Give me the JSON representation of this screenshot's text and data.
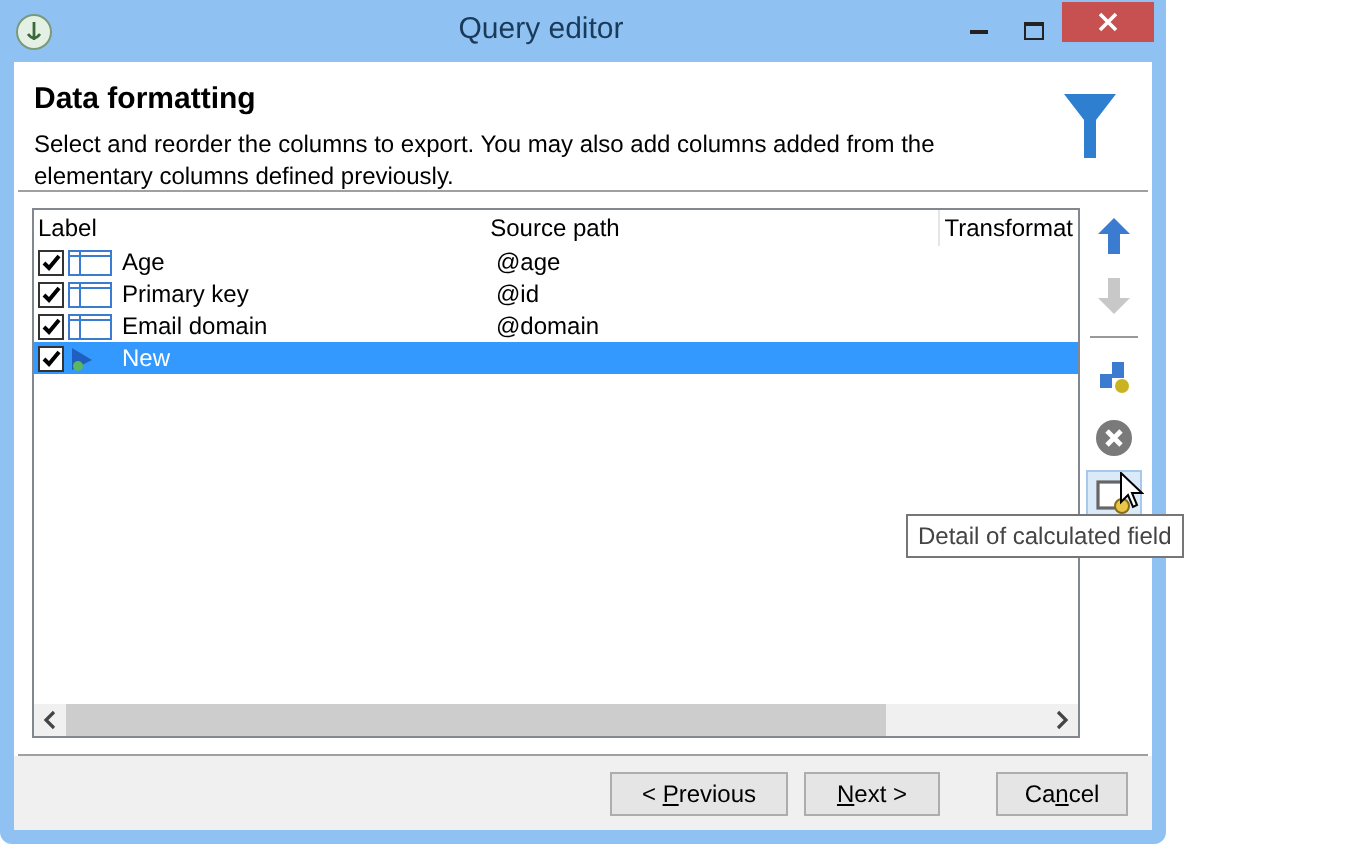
{
  "window": {
    "title": "Query editor"
  },
  "header": {
    "title": "Data formatting",
    "description": "Select and reorder the columns to export. You may also add columns added from the elementary columns defined previously."
  },
  "table": {
    "columns": [
      "Label",
      "Source path",
      "Transformat"
    ],
    "rows": [
      {
        "label": "Age",
        "source": "@age",
        "checked": true,
        "kind": "column",
        "selected": false
      },
      {
        "label": "Primary key",
        "source": "@id",
        "checked": true,
        "kind": "column",
        "selected": false
      },
      {
        "label": "Email domain",
        "source": "@domain",
        "checked": true,
        "kind": "column",
        "selected": false
      },
      {
        "label": "New",
        "checked": true,
        "kind": "calculated",
        "selected": true
      }
    ]
  },
  "toolbar": [
    {
      "kind": "up",
      "disabled": false,
      "hovered": false
    },
    {
      "kind": "down",
      "disabled": true,
      "hovered": false
    },
    {
      "kind": "separator"
    },
    {
      "kind": "add",
      "disabled": false,
      "hovered": false
    },
    {
      "kind": "delete",
      "disabled": false,
      "hovered": false
    },
    {
      "kind": "detail",
      "disabled": false,
      "hovered": true
    }
  ],
  "tooltip": "Detail of calculated field",
  "buttons": [
    {
      "before": "< ",
      "key": "P",
      "after": "revious"
    },
    {
      "key": "N",
      "after": "ext >"
    },
    {
      "before": "Ca",
      "key": "n",
      "after": "cel"
    }
  ]
}
